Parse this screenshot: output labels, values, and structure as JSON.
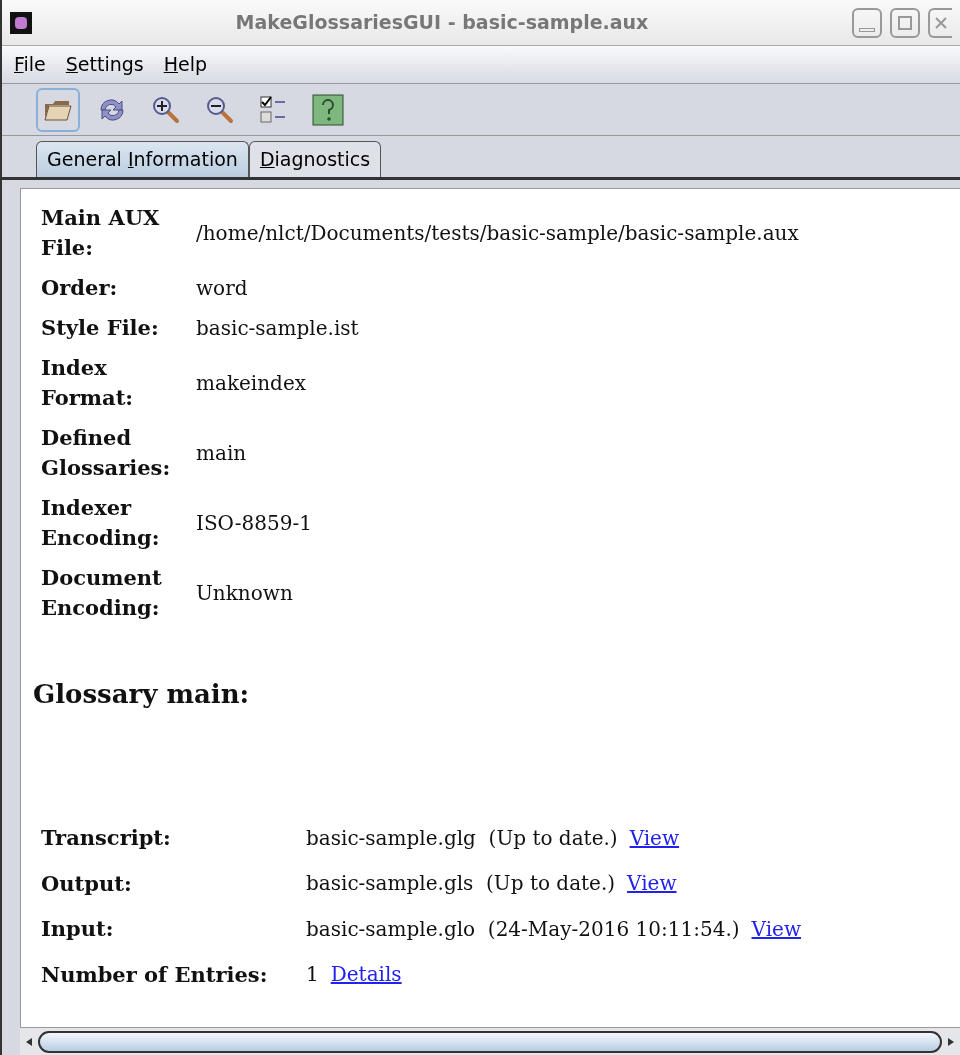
{
  "window": {
    "title": "MakeGlossariesGUI - basic-sample.aux"
  },
  "menu": [
    {
      "key": "F",
      "rest": "ile"
    },
    {
      "key": "S",
      "rest": "ettings"
    },
    {
      "key": "H",
      "rest": "elp"
    }
  ],
  "toolbar": [
    {
      "kind": "open",
      "selected": true
    },
    {
      "kind": "reload",
      "selected": false
    },
    {
      "kind": "zoom-in",
      "selected": false
    },
    {
      "kind": "zoom-out",
      "selected": false
    },
    {
      "kind": "checklist",
      "selected": false
    },
    {
      "kind": "help",
      "selected": false
    }
  ],
  "tabs": [
    {
      "before": "General ",
      "key": "I",
      "rest": "nformation",
      "selected": true
    },
    {
      "key": "D",
      "rest": "iagnostics",
      "selected": false
    }
  ],
  "info": [
    {
      "label": "Main AUX File:",
      "value": "/home/nlct/Documents/tests/basic-sample/basic-sample.aux"
    },
    {
      "label": "Order:",
      "value": "word"
    },
    {
      "label": "Style File:",
      "value": "basic-sample.ist"
    },
    {
      "label": "Index Format:",
      "value": "makeindex"
    },
    {
      "label": "Defined Glossaries:",
      "value": "main"
    },
    {
      "label": "Indexer Encoding:",
      "value": "ISO-8859-1"
    },
    {
      "label": "Document Encoding:",
      "value": "Unknown"
    }
  ],
  "glossary": {
    "heading": "Glossary main:",
    "rows": [
      {
        "label": "Transcript:",
        "value": "basic-sample.glg  (Up to date.)",
        "link": "View"
      },
      {
        "label": "Output:",
        "value": "basic-sample.gls  (Up to date.)",
        "link": "View"
      },
      {
        "label": "Input:",
        "value": "basic-sample.glo  (24-May-2016 10:11:54.)",
        "link": "View"
      },
      {
        "label": "Number of Entries:",
        "value": "1",
        "link": "Details"
      }
    ]
  }
}
